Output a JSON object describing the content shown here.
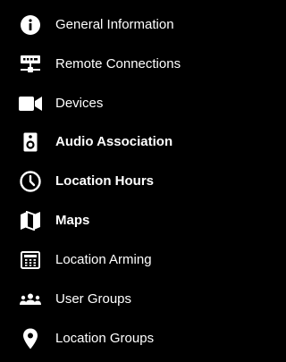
{
  "menu": {
    "items": [
      {
        "label": "General Information",
        "icon": "info-circle-icon"
      },
      {
        "label": "Remote Connections",
        "icon": "network-icon"
      },
      {
        "label": "Devices",
        "icon": "video-camera-icon"
      },
      {
        "label": "Audio Association",
        "icon": "speaker-icon"
      },
      {
        "label": "Location Hours",
        "icon": "clock-icon"
      },
      {
        "label": "Maps",
        "icon": "map-icon"
      },
      {
        "label": "Location Arming",
        "icon": "keypad-icon"
      },
      {
        "label": "User Groups",
        "icon": "users-icon"
      },
      {
        "label": "Location Groups",
        "icon": "map-pin-icon"
      }
    ]
  },
  "colors": {
    "background": "#000000",
    "text": "#ffffff"
  }
}
